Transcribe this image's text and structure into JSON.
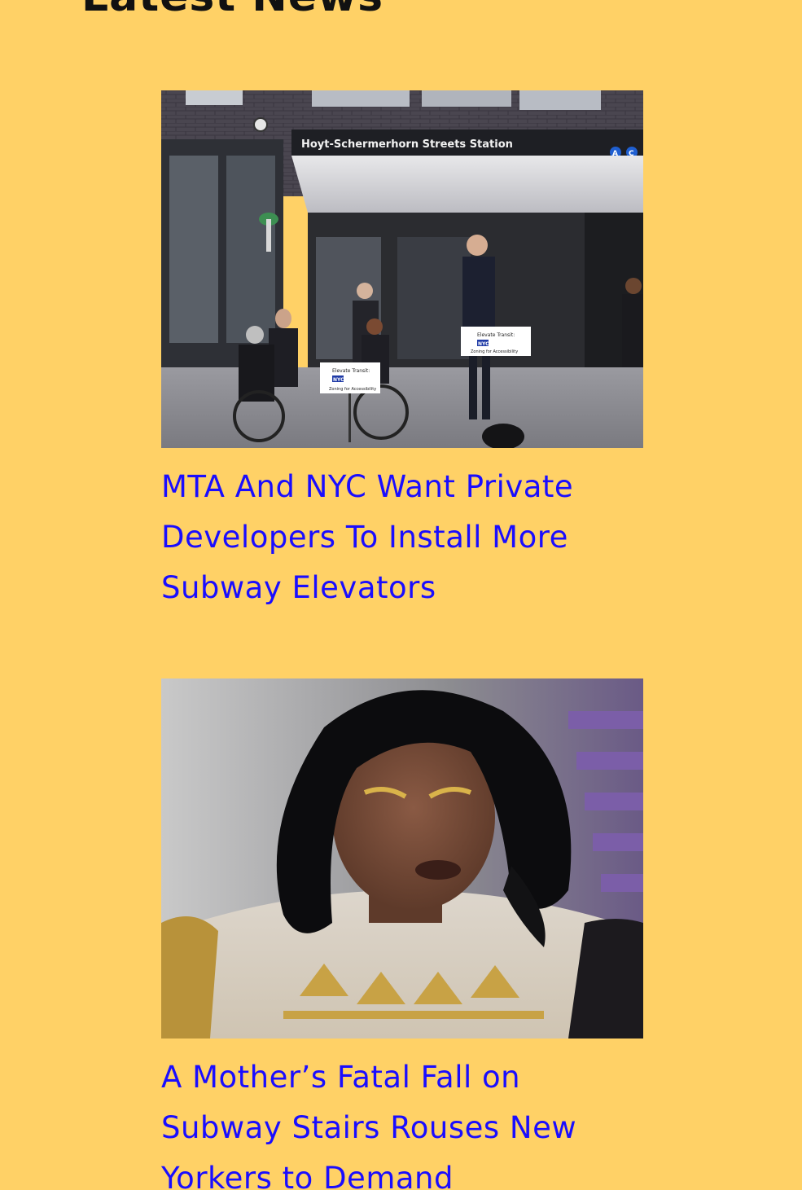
{
  "section": {
    "title": "Latest News"
  },
  "articles": [
    {
      "headline": "MTA And NYC Want Private Developers To Install More Subway Elevators",
      "image": {
        "station_sign": "Hoyt-Schermerhorn Streets Station",
        "line_badges": [
          "A",
          "C"
        ],
        "placards": [
          {
            "line1": "Elevate Transit:",
            "line2": "NYC",
            "line3": "Zoning for Accessibility"
          },
          {
            "line1": "Elevate Transit:",
            "line2": "NYC",
            "line3": "Zoning for Accessibility"
          }
        ]
      }
    },
    {
      "headline": "A Mother’s Fatal Fall on Subway Stairs Rouses New Yorkers to Demand"
    }
  ],
  "colors": {
    "background": "#ffd166",
    "link": "#1a0dff",
    "title": "#111111"
  }
}
